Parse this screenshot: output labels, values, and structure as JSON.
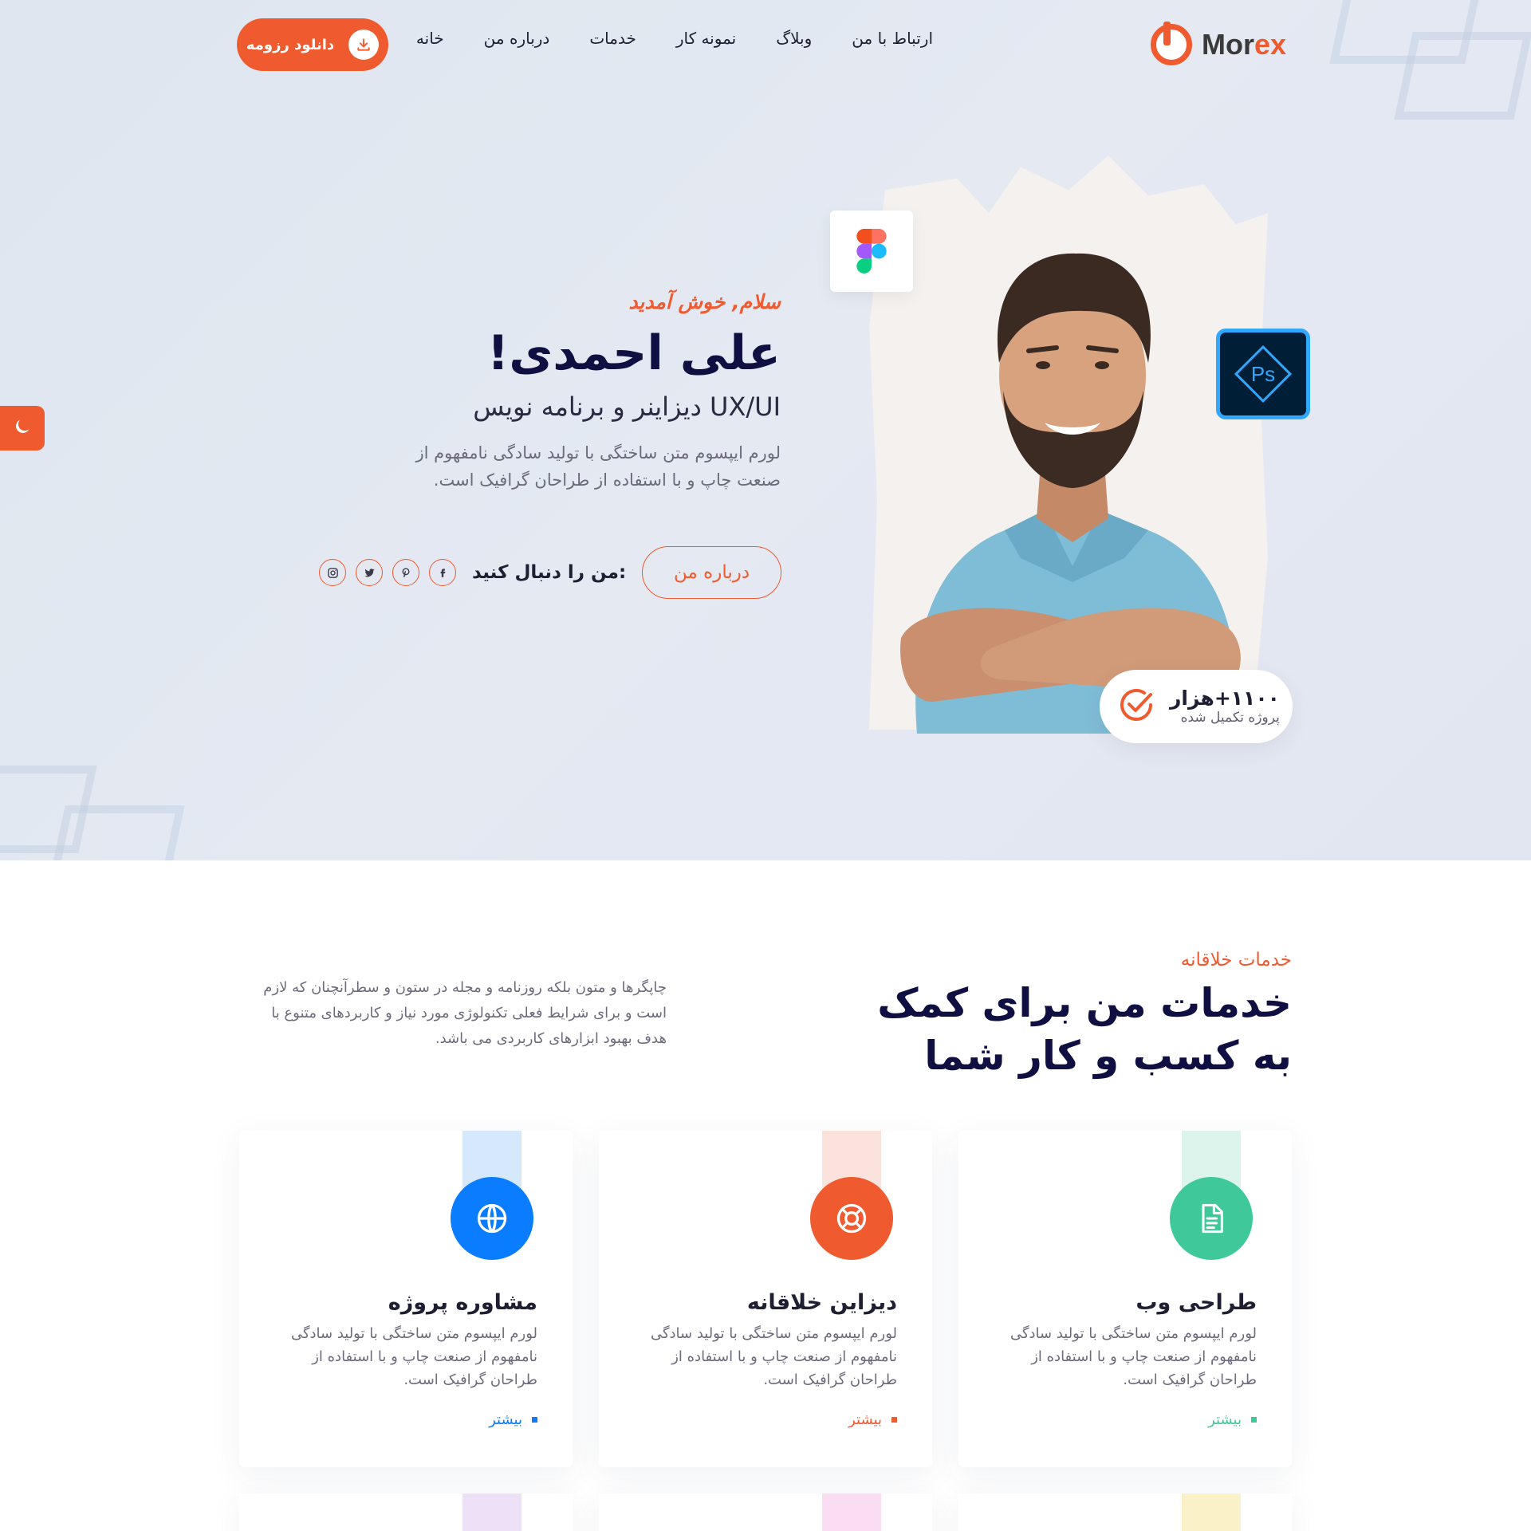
{
  "brand": {
    "name_main": "Mor",
    "name_accent": "ex"
  },
  "nav": {
    "items": [
      {
        "label": "خانه"
      },
      {
        "label": "درباره من"
      },
      {
        "label": "خدمات"
      },
      {
        "label": "نمونه کار"
      },
      {
        "label": "وبلاگ"
      },
      {
        "label": "ارتباط با من"
      }
    ],
    "resume_button": "دانلود رزومه"
  },
  "hero": {
    "greeting": "سلام, خوش آمدید",
    "name": "علی احمدی!",
    "role": "UX/UI دیزاینر و برنامه نویس",
    "description": "لورم ایپسوم متن ساختگی با تولید سادگی نامفهوم از صنعت چاپ و با استفاده از طراحان گرافیک است.",
    "about_button": "درباره من",
    "follow_label": "من را دنبال کنید:",
    "socials": [
      {
        "icon": "facebook-icon"
      },
      {
        "icon": "pinterest-icon"
      },
      {
        "icon": "twitter-icon"
      },
      {
        "icon": "instagram-icon"
      }
    ],
    "stat": {
      "number": "۱۱۰۰+هزار",
      "label": "پروژه تکمیل شده"
    },
    "badges": {
      "figma": "figma-icon",
      "photoshop": "Ps"
    }
  },
  "services": {
    "kicker": "خدمات خلاقانه",
    "title": "خدمات من برای کمک به کسب و کار شما",
    "description": "چاپگرها و متون بلکه روزنامه و مجله در ستون و سطرآنچنان که لازم است و برای شرایط فعلی تکنولوژی مورد نیاز و کاربردهای متنوع با هدف بهبود ابزارهای کاربردی می باشد.",
    "cards": [
      {
        "title": "طراحی وب",
        "description": "لورم ایپسوم متن ساختگی با تولید سادگی نامفهوم از صنعت چاپ و با استفاده از طراحان گرافیک است.",
        "more": "بیشتر",
        "icon": "document-icon",
        "color": "#3fc89a",
        "band": "#dcf4eb"
      },
      {
        "title": "دیزاین خلاقانه",
        "description": "لورم ایپسوم متن ساختگی با تولید سادگی نامفهوم از صنعت چاپ و با استفاده از طراحان گرافیک است.",
        "more": "بیشتر",
        "icon": "lifebuoy-icon",
        "color": "#f05a2f",
        "band": "#fbe2dc"
      },
      {
        "title": "مشاوره پروژه",
        "description": "لورم ایپسوم متن ساختگی با تولید سادگی نامفهوم از صنعت چاپ و با استفاده از طراحان گرافیک است.",
        "more": "بیشتر",
        "icon": "globe-icon",
        "color": "#0a7cff",
        "band": "#d6e8fb"
      }
    ],
    "peek_bands": [
      "#fbf1c8",
      "#fadcf3",
      "#ece1f6"
    ]
  },
  "colors": {
    "accent": "#f05a2f",
    "heading": "#0f1041"
  }
}
